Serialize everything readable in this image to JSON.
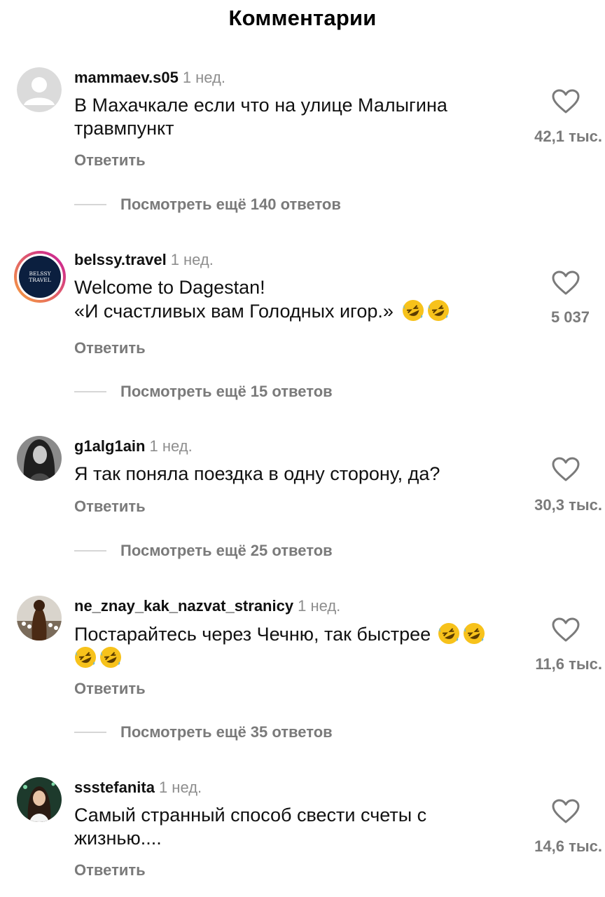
{
  "header": {
    "title": "Комментарии"
  },
  "reply_label": "Ответить",
  "comments": [
    {
      "username": "mammaev.s05",
      "time": "1 нед.",
      "lines": [
        "В Махачкале если что на улице Малыгина",
        "травмпункт"
      ],
      "likes": "42,1 тыс.",
      "view_more": "Посмотреть ещё 140 ответов"
    },
    {
      "username": "belssy.travel",
      "time": "1 нед.",
      "avatar_text": [
        "BELSSY",
        "TRAVEL"
      ],
      "lines": [
        "Welcome to Dagestan!",
        "«И счастливых вам Голодных игор.»"
      ],
      "likes": "5 037",
      "view_more": "Посмотреть ещё 15 ответов"
    },
    {
      "username": "g1alg1ain",
      "time": "1 нед.",
      "lines": [
        "Я так поняла поездка в одну сторону, да?"
      ],
      "likes": "30,3 тыс.",
      "view_more": "Посмотреть ещё 25 ответов"
    },
    {
      "username": "ne_znay_kak_nazvat_stranicy",
      "time": "1 нед.",
      "lines": [
        "Постарайтесь через Чечню, так быстрее"
      ],
      "likes": "11,6 тыс.",
      "view_more": "Посмотреть ещё 35 ответов"
    },
    {
      "username": "ssstefanita",
      "time": "1 нед.",
      "lines": [
        "Самый странный способ свести счеты с",
        "жизнью...."
      ],
      "likes": "14,6 тыс."
    }
  ],
  "icons": {
    "like": "heart-outline-icon",
    "emoji": "rolling-on-floor-laughing-emoji"
  },
  "colors": {
    "secondary_text": "#7a7a7a",
    "time_text": "#8e8e8e",
    "story_ring_start": "#f9a43a",
    "story_ring_end": "#c8189b"
  }
}
